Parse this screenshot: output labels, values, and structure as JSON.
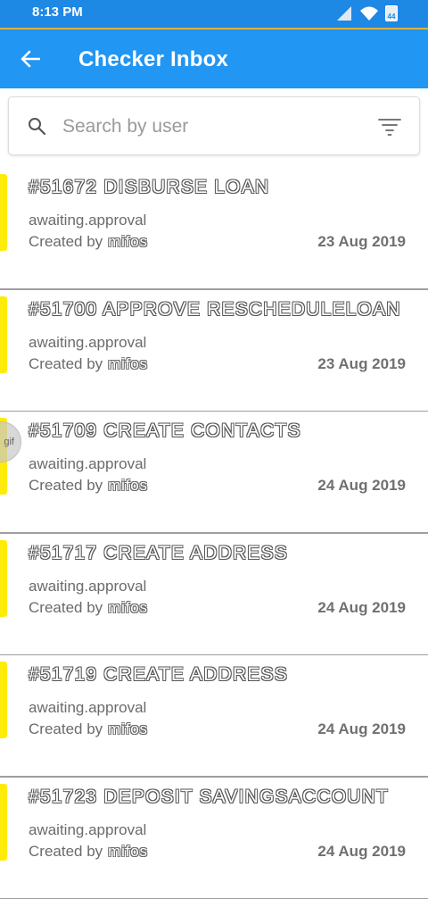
{
  "status_bar": {
    "time": "8:13 PM",
    "battery": "44"
  },
  "app_bar": {
    "title": "Checker Inbox",
    "back_icon": "arrow-left-icon"
  },
  "search": {
    "placeholder": "Search by user",
    "value": ""
  },
  "items": [
    {
      "title": "#51672 DISBURSE LOAN",
      "status": "awaiting.approval",
      "created_label": "Created by",
      "user": "mifos",
      "date": "23 Aug 2019"
    },
    {
      "title": "#51700 APPROVE RESCHEDULELOAN",
      "status": "awaiting.approval",
      "created_label": "Created by",
      "user": "mifos",
      "date": "23 Aug 2019"
    },
    {
      "title": "#51709 CREATE CONTACTS",
      "status": "awaiting.approval",
      "created_label": "Created by",
      "user": "mifos",
      "date": "24 Aug 2019"
    },
    {
      "title": "#51717 CREATE ADDRESS",
      "status": "awaiting.approval",
      "created_label": "Created by",
      "user": "mifos",
      "date": "24 Aug 2019"
    },
    {
      "title": "#51719 CREATE ADDRESS",
      "status": "awaiting.approval",
      "created_label": "Created by",
      "user": "mifos",
      "date": "24 Aug 2019"
    },
    {
      "title": "#51723 DEPOSIT SAVINGSACCOUNT",
      "status": "awaiting.approval",
      "created_label": "Created by",
      "user": "mifos",
      "date": "24 Aug 2019"
    }
  ],
  "floating_badge": {
    "label": "gif"
  },
  "colors": {
    "app_bar": "#2196f3",
    "status_bar": "#1e88e5",
    "item_accent": "#ffeb0a"
  }
}
